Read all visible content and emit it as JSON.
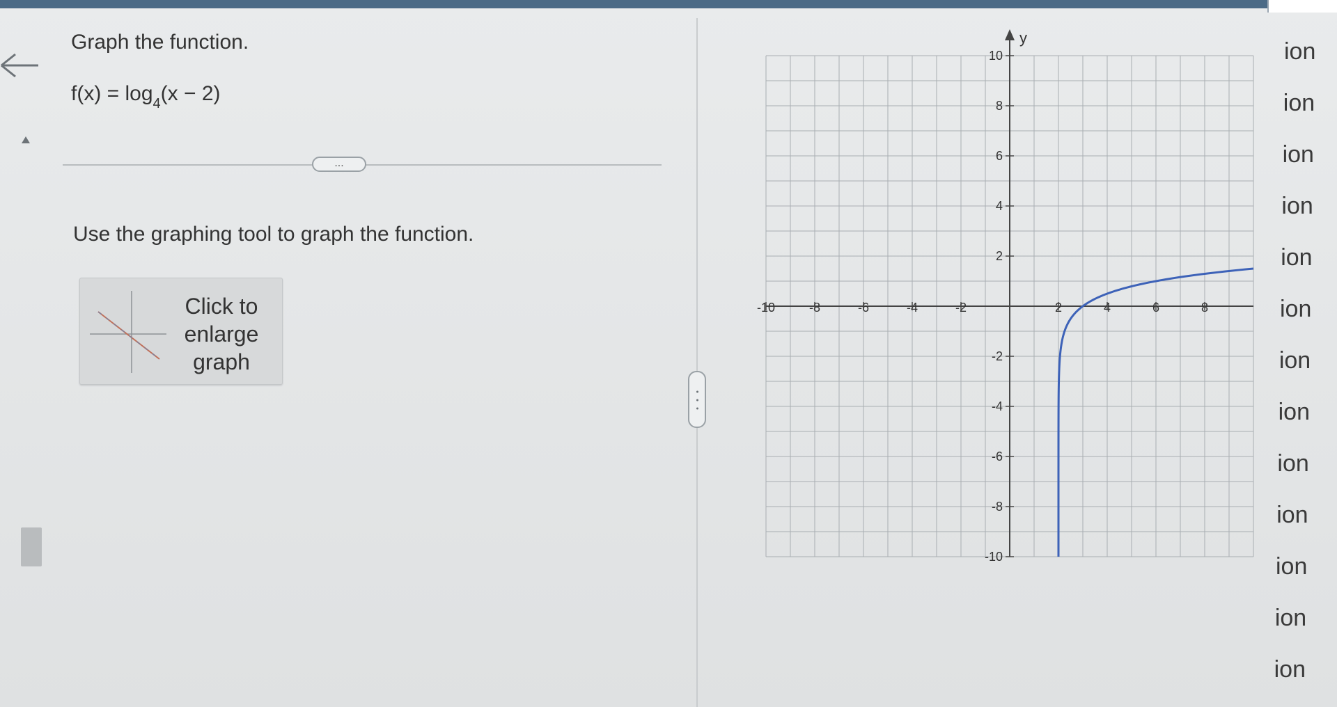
{
  "question": {
    "title": "Graph the function.",
    "formula": {
      "lhs": "f(x) = log",
      "base": "4",
      "arg": "(x − 2)"
    },
    "more_button": "...",
    "instruction": "Use the graphing tool to graph the function.",
    "enlarge_button": {
      "line1": "Click to",
      "line2": "enlarge",
      "line3": "graph"
    }
  },
  "graph": {
    "axis_y_label": "y",
    "x_tick_labels": [
      "-10",
      "-8",
      "-6",
      "-4",
      "-2",
      "2",
      "4",
      "6",
      "8"
    ],
    "y_tick_labels": [
      "10",
      "8",
      "6",
      "4",
      "2",
      "-2",
      "-4",
      "-6",
      "-8",
      "-10"
    ],
    "x_range": [
      -10,
      10
    ],
    "y_range": [
      -10,
      10
    ],
    "grid": true,
    "curve_color": "#3d62b8",
    "function": "log4(x-2)"
  },
  "answer_list": {
    "items": [
      "ion",
      "ion",
      "ion",
      "ion",
      "ion",
      "ion",
      "ion",
      "ion",
      "ion",
      "ion",
      "ion",
      "ion",
      "ion"
    ]
  },
  "colors": {
    "top_bar": "#4b6a86",
    "curve": "#3d62b8"
  },
  "icons": {
    "back": "back-arrow-icon",
    "collapse": "caret-up-icon",
    "more": "ellipsis-icon",
    "splitter": "drag-handle-icon"
  }
}
